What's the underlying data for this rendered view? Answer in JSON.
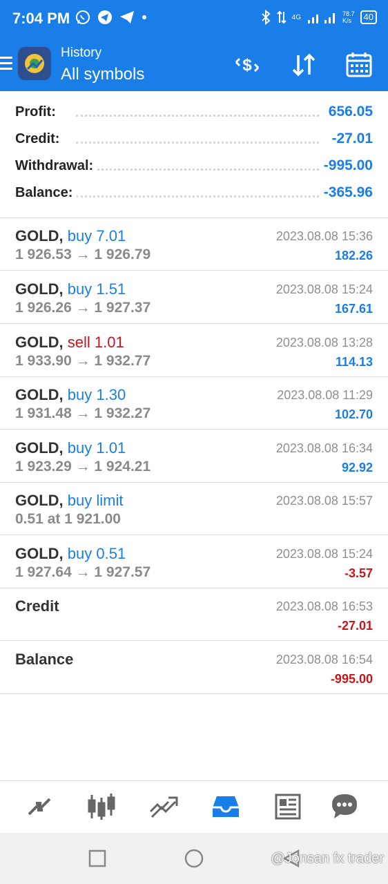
{
  "status_bar": {
    "time": "7:04 PM",
    "network_type": "4G",
    "speed_value": "78.7",
    "speed_unit": "K/s",
    "battery": "40"
  },
  "app_bar": {
    "subtitle": "History",
    "title": "All symbols",
    "accent_color": "#1a7ee8"
  },
  "summary": [
    {
      "label": "Profit:",
      "value": "656.05"
    },
    {
      "label": "Credit:",
      "value": "-27.01"
    },
    {
      "label": "Withdrawal:",
      "value": "-995.00"
    },
    {
      "label": "Balance:",
      "value": "-365.96"
    }
  ],
  "trades": [
    {
      "symbol": "GOLD,",
      "action": "buy 7.01",
      "action_color": "blue",
      "prices": "1 926.53 → 1 926.79",
      "date": "2023.08.08 15:36",
      "profit": "182.26",
      "profit_color": "blue"
    },
    {
      "symbol": "GOLD,",
      "action": "buy 1.51",
      "action_color": "blue",
      "prices": "1 926.26 → 1 927.37",
      "date": "2023.08.08 15:24",
      "profit": "167.61",
      "profit_color": "blue"
    },
    {
      "symbol": "GOLD,",
      "action": "sell 1.01",
      "action_color": "red",
      "prices": "1 933.90 → 1 932.77",
      "date": "2023.08.08 13:28",
      "profit": "114.13",
      "profit_color": "blue"
    },
    {
      "symbol": "GOLD,",
      "action": "buy 1.30",
      "action_color": "blue",
      "prices": "1 931.48 → 1 932.27",
      "date": "2023.08.08 11:29",
      "profit": "102.70",
      "profit_color": "blue"
    },
    {
      "symbol": "GOLD,",
      "action": "buy 1.01",
      "action_color": "blue",
      "prices": "1 923.29 → 1 924.21",
      "date": "2023.08.08 16:34",
      "profit": "92.92",
      "profit_color": "blue"
    },
    {
      "symbol": "GOLD,",
      "action": "buy limit",
      "action_color": "blue",
      "prices": "0.51 at 1 921.00",
      "date": "2023.08.08 15:57",
      "profit": "",
      "profit_color": "blue"
    },
    {
      "symbol": "GOLD,",
      "action": "buy 0.51",
      "action_color": "blue",
      "prices": "1 927.64 → 1 927.57",
      "date": "2023.08.08 15:24",
      "profit": "-3.57",
      "profit_color": "red"
    },
    {
      "symbol": "Credit",
      "action": "",
      "action_color": "blue",
      "prices": "",
      "date": "2023.08.08 16:53",
      "profit": "-27.01",
      "profit_color": "red"
    },
    {
      "symbol": "Balance",
      "action": "",
      "action_color": "blue",
      "prices": "",
      "date": "2023.08.08 16:54",
      "profit": "-995.00",
      "profit_color": "red"
    }
  ],
  "bottom_nav": [
    "quotes-icon",
    "chart-icon",
    "trade-icon",
    "history-icon",
    "news-icon",
    "messages-icon"
  ],
  "watermark": "@Jonsan fx trader"
}
